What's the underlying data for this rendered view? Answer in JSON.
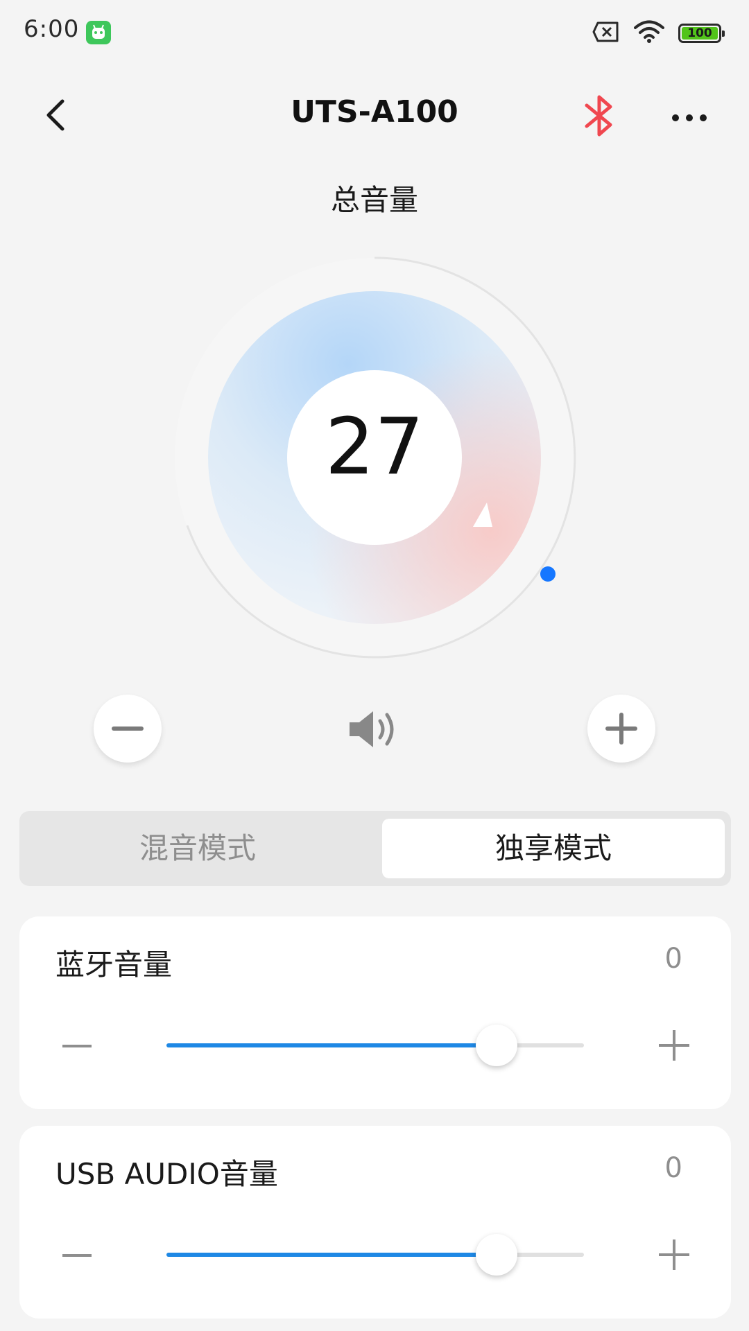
{
  "status_bar": {
    "time": "6:00",
    "app_icon": "android-robot-icon",
    "sim_icon": "no-sim-icon",
    "wifi_icon": "wifi-icon",
    "battery_text": "100",
    "battery_level": 1.0
  },
  "header": {
    "title": "UTS-A100",
    "back_icon": "chevron-left-icon",
    "bluetooth_icon": "bluetooth-icon",
    "more_icon": "more-horizontal-icon",
    "bluetooth_color": "#f0474f"
  },
  "master": {
    "label": "总音量",
    "value": "27",
    "indicator_color": "#1677ff",
    "speaker_icon": "speaker-icon"
  },
  "modes": {
    "tabs": [
      {
        "label": "混音模式",
        "selected": false
      },
      {
        "label": "独享模式",
        "selected": true
      }
    ]
  },
  "channels": [
    {
      "label": "蓝牙音量",
      "value": "0",
      "level": 0.79
    },
    {
      "label": "USB AUDIO音量",
      "value": "0",
      "level": 0.79
    }
  ],
  "colors": {
    "accent": "#1e88e5",
    "background": "#f4f4f4"
  }
}
